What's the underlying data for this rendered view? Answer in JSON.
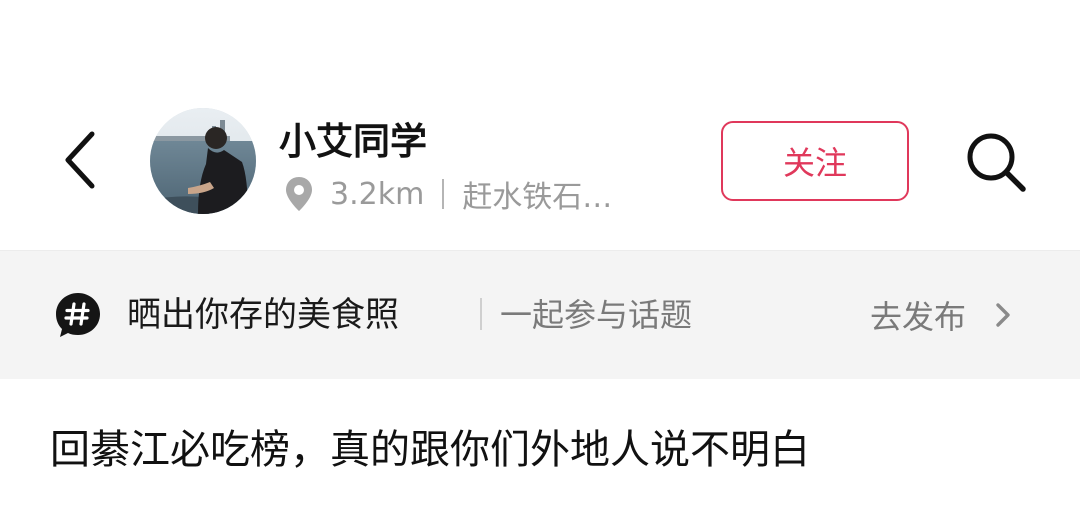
{
  "header": {
    "author_name": "小艾同学",
    "distance": "3.2km",
    "location": "赶水铁石…",
    "follow_label": "关注",
    "back_icon": "chevron-left-icon",
    "search_icon": "search-icon",
    "location_icon": "location-pin-icon"
  },
  "topic": {
    "icon": "hashtag-bubble-icon",
    "title": "晒出你存的美食照",
    "subtitle": "一起参与话题",
    "action_label": "去发布",
    "action_icon": "chevron-right-icon"
  },
  "post": {
    "title": "回綦江必吃榜，真的跟你们外地人说不明白"
  },
  "colors": {
    "accent": "#e0385b",
    "banner_bg": "#f4f4f4",
    "muted_text": "#9a9a9a"
  }
}
